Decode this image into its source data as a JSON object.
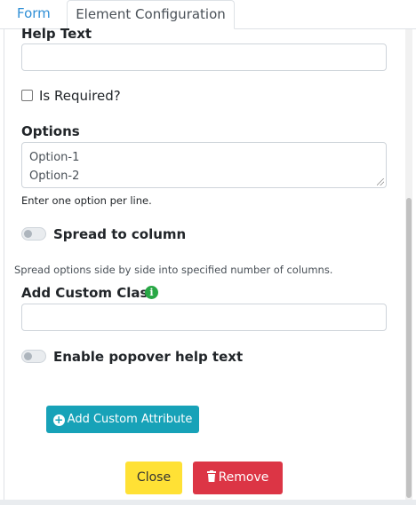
{
  "tabs": [
    {
      "label": "Form"
    },
    {
      "label": "Element Configuration"
    }
  ],
  "help_text": {
    "label": "Help Text",
    "value": ""
  },
  "is_required": {
    "label": "Is Required?",
    "checked": false
  },
  "options": {
    "label": "Options",
    "lines": [
      "Option-1",
      "Option-2"
    ],
    "hint": "Enter one option per line."
  },
  "spread": {
    "label": "Spread to column",
    "enabled": false,
    "hint": "Spread options side by side into specified number of columns."
  },
  "custom_class": {
    "label": "Add Custom Class",
    "value": ""
  },
  "popover": {
    "label": "Enable popover help text",
    "enabled": false
  },
  "buttons": {
    "add_attribute": "Add Custom Attribute",
    "close": "Close",
    "remove": "Remove"
  },
  "colors": {
    "accent": "#2f8fd6",
    "teal": "#17a2b8",
    "close_yellow": "#ffe135",
    "remove_red": "#dc3545",
    "info_green": "#28a745"
  },
  "icons": {
    "info": "info-circle-icon",
    "plus": "plus-circle-icon",
    "trash": "trash-icon"
  }
}
